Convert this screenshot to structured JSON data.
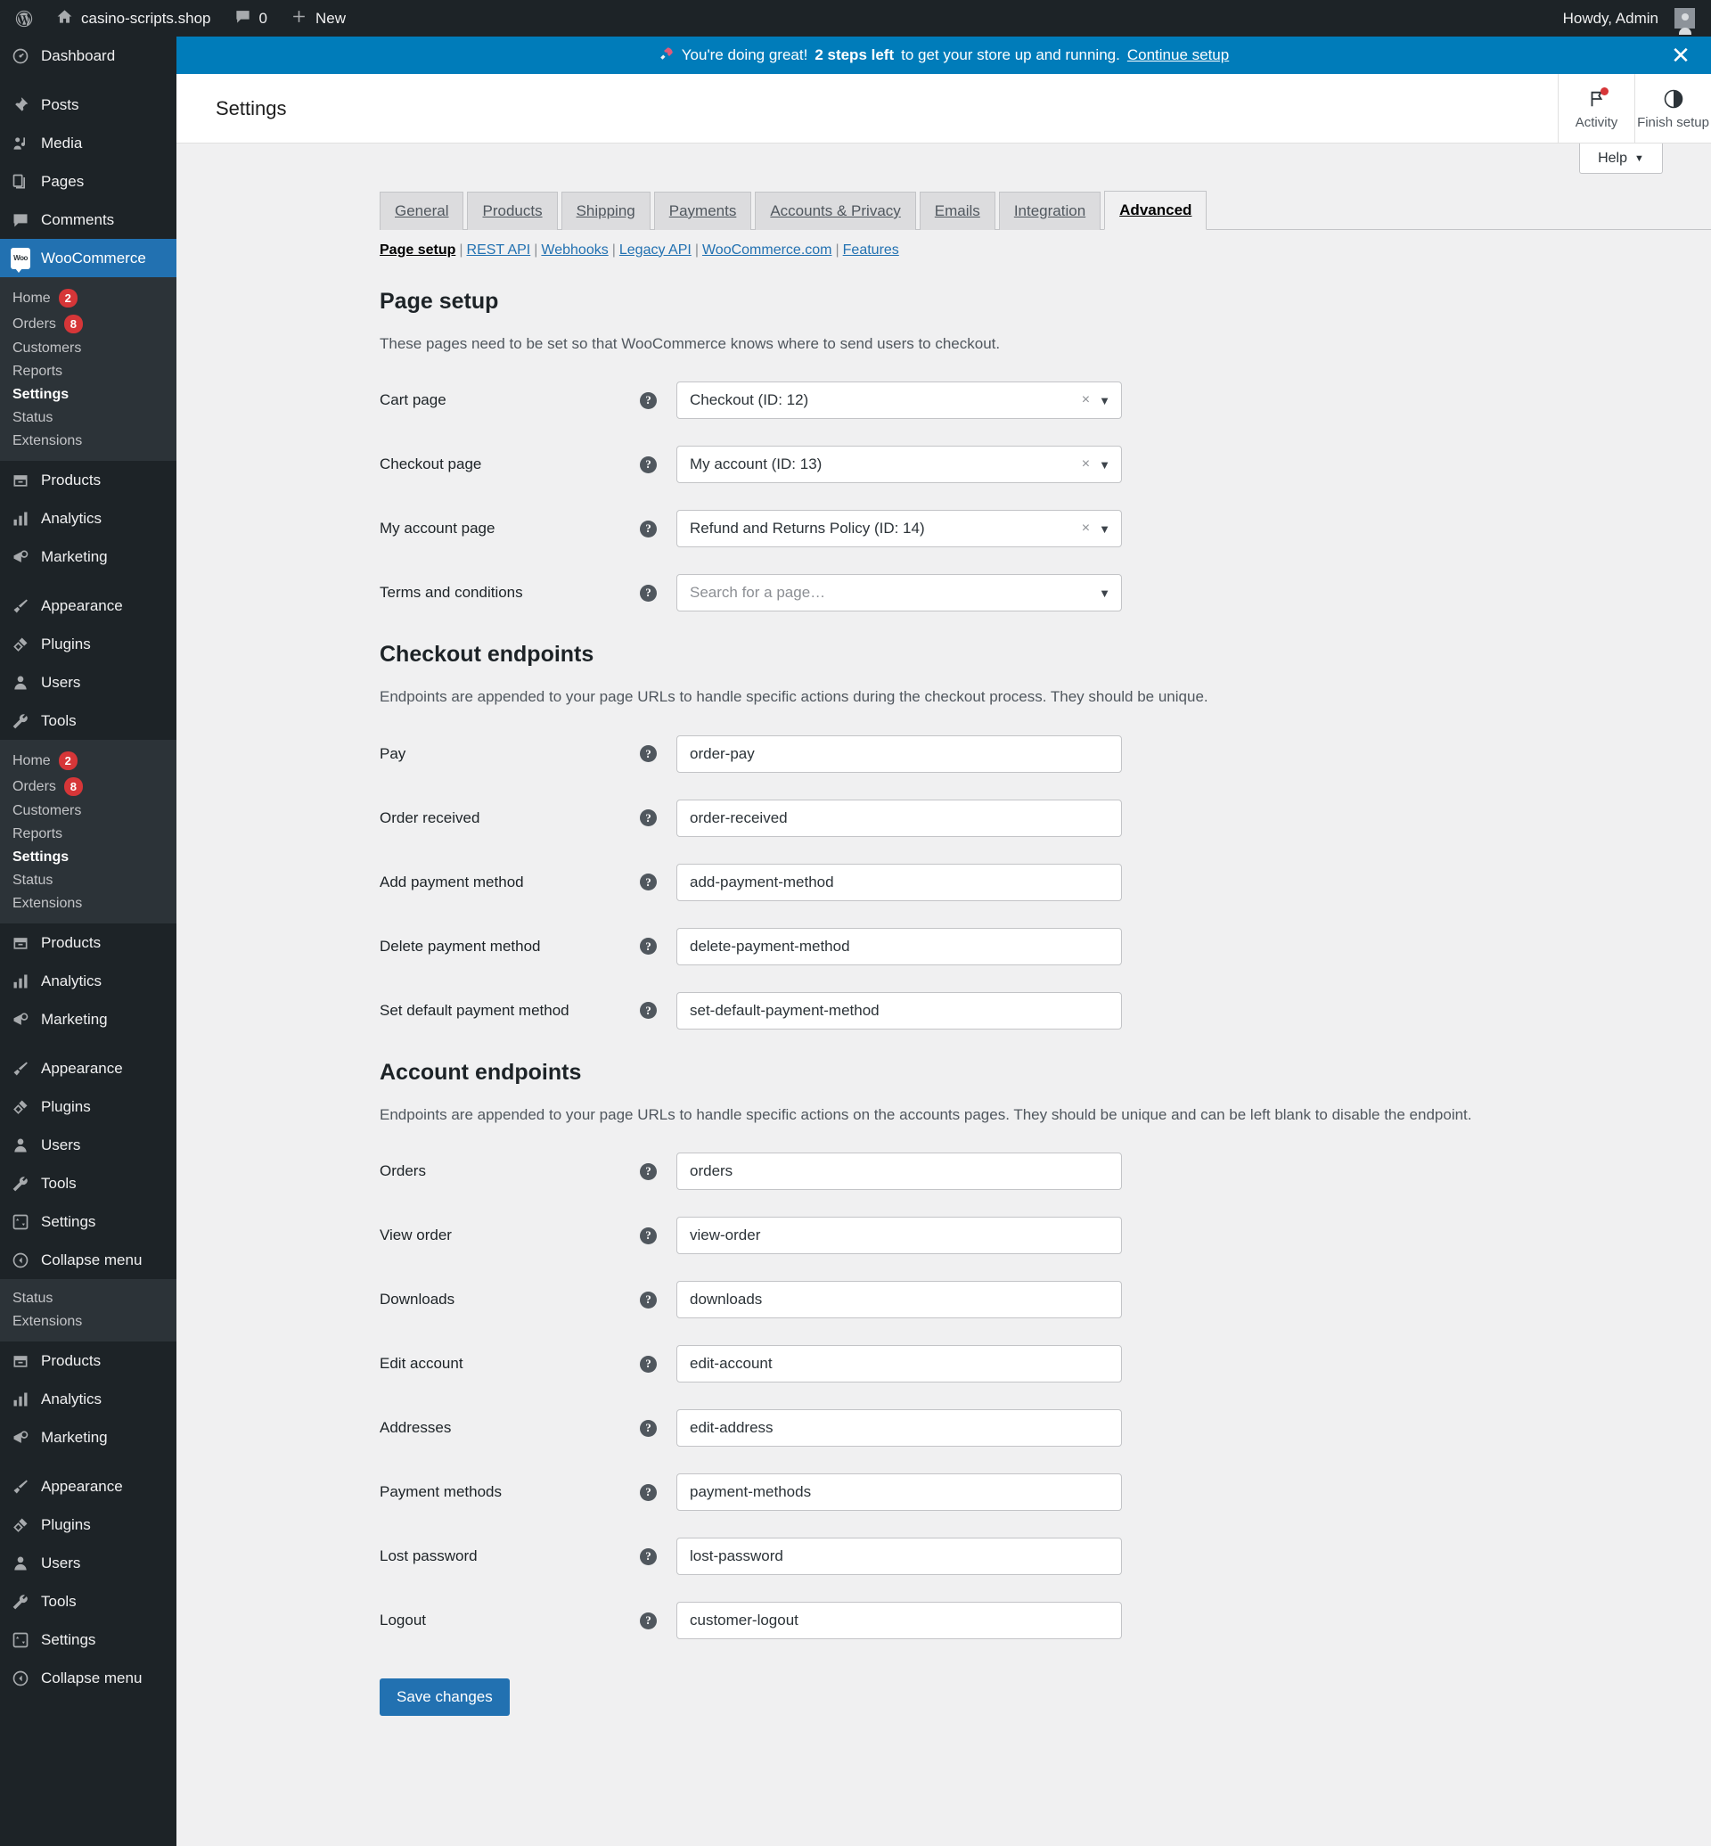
{
  "adminbar": {
    "site_name": "casino-scripts.shop",
    "comment_count": "0",
    "new_label": "New",
    "howdy": "Howdy, Admin",
    "wp_logo_icon": "wordpress-logo-icon",
    "home_icon": "home-icon",
    "comment_icon": "comment-bubble-icon",
    "plus_icon": "plus-icon",
    "avatar_icon": "user-avatar-icon"
  },
  "sidebar": {
    "top_items": [
      {
        "label": "Dashboard",
        "icon": "dashboard-gauge-icon",
        "sep": false,
        "current": false
      },
      {
        "label": "Posts",
        "icon": "pin-icon",
        "sep": true,
        "current": false
      },
      {
        "label": "Media",
        "icon": "media-icon",
        "sep": false,
        "current": false
      },
      {
        "label": "Pages",
        "icon": "pages-icon",
        "sep": false,
        "current": false
      },
      {
        "label": "Comments",
        "icon": "comment-bubble-icon",
        "sep": false,
        "current": false
      }
    ],
    "woocommerce": {
      "label": "WooCommerce",
      "icon": "woo-logo-icon"
    },
    "woo_submenu": [
      {
        "label": "Home",
        "badge": "2",
        "current": false
      },
      {
        "label": "Orders",
        "badge": "8",
        "current": false
      },
      {
        "label": "Customers",
        "badge": "",
        "current": false
      },
      {
        "label": "Reports",
        "badge": "",
        "current": false
      },
      {
        "label": "Settings",
        "badge": "",
        "current": true
      },
      {
        "label": "Status",
        "badge": "",
        "current": false
      },
      {
        "label": "Extensions",
        "badge": "",
        "current": false
      }
    ],
    "group_a": [
      {
        "label": "Products",
        "icon": "products-box-icon",
        "sep": false
      },
      {
        "label": "Analytics",
        "icon": "analytics-bars-icon",
        "sep": false
      },
      {
        "label": "Marketing",
        "icon": "megaphone-icon",
        "sep": false
      },
      {
        "label": "Appearance",
        "icon": "paintbrush-icon",
        "sep": true
      },
      {
        "label": "Plugins",
        "icon": "plug-icon",
        "sep": false
      },
      {
        "label": "Users",
        "icon": "user-icon",
        "sep": false
      },
      {
        "label": "Tools",
        "icon": "wrench-icon",
        "sep": false
      }
    ],
    "group_b": [
      {
        "label": "Products",
        "icon": "products-box-icon",
        "sep": false
      },
      {
        "label": "Analytics",
        "icon": "analytics-bars-icon",
        "sep": false
      },
      {
        "label": "Marketing",
        "icon": "megaphone-icon",
        "sep": false
      },
      {
        "label": "Appearance",
        "icon": "paintbrush-icon",
        "sep": true
      },
      {
        "label": "Plugins",
        "icon": "plug-icon",
        "sep": false
      },
      {
        "label": "Users",
        "icon": "user-icon",
        "sep": false
      },
      {
        "label": "Tools",
        "icon": "wrench-icon",
        "sep": false
      },
      {
        "label": "Settings",
        "icon": "settings-sliders-icon",
        "sep": false
      },
      {
        "label": "Collapse menu",
        "icon": "collapse-arrow-icon",
        "sep": false
      }
    ],
    "partial_submenu": [
      {
        "label": "Status"
      },
      {
        "label": "Extensions"
      }
    ],
    "group_c": [
      {
        "label": "Products",
        "icon": "products-box-icon",
        "sep": false
      },
      {
        "label": "Analytics",
        "icon": "analytics-bars-icon",
        "sep": false
      },
      {
        "label": "Marketing",
        "icon": "megaphone-icon",
        "sep": false
      },
      {
        "label": "Appearance",
        "icon": "paintbrush-icon",
        "sep": true
      },
      {
        "label": "Plugins",
        "icon": "plug-icon",
        "sep": false
      },
      {
        "label": "Users",
        "icon": "user-icon",
        "sep": false
      },
      {
        "label": "Tools",
        "icon": "wrench-icon",
        "sep": false
      },
      {
        "label": "Settings",
        "icon": "settings-sliders-icon",
        "sep": false
      },
      {
        "label": "Collapse menu",
        "icon": "collapse-arrow-icon",
        "sep": false
      }
    ]
  },
  "notice": {
    "rocket_icon": "rocket-icon",
    "prefix": "You're doing great!",
    "bold": "2 steps left",
    "suffix": "to get your store up and running.",
    "link": "Continue setup",
    "close_icon": "close-icon",
    "bg": "#007cba"
  },
  "header": {
    "title": "Settings",
    "activity": {
      "label": "Activity",
      "icon": "flag-icon",
      "has_dot": true
    },
    "finish_setup": {
      "label": "Finish setup",
      "icon": "progress-circle-icon"
    },
    "help": {
      "label": "Help",
      "icon": "chevron-down-icon"
    }
  },
  "tabs": [
    {
      "label": "General",
      "active": false
    },
    {
      "label": "Products",
      "active": false
    },
    {
      "label": "Shipping",
      "active": false
    },
    {
      "label": "Payments",
      "active": false
    },
    {
      "label": "Accounts & Privacy",
      "active": false
    },
    {
      "label": "Emails",
      "active": false
    },
    {
      "label": "Integration",
      "active": false
    },
    {
      "label": "Advanced",
      "active": true
    }
  ],
  "subnav": [
    {
      "label": "Page setup",
      "current": true
    },
    {
      "label": "REST API",
      "current": false
    },
    {
      "label": "Webhooks",
      "current": false
    },
    {
      "label": "Legacy API",
      "current": false
    },
    {
      "label": "WooCommerce.com",
      "current": false
    },
    {
      "label": "Features",
      "current": false
    }
  ],
  "page_setup": {
    "title": "Page setup",
    "description": "These pages need to be set so that WooCommerce knows where to send users to checkout.",
    "fields": [
      {
        "label": "Cart page",
        "value": "Checkout (ID: 12)",
        "placeholder": "",
        "clearable": true
      },
      {
        "label": "Checkout page",
        "value": "My account (ID: 13)",
        "placeholder": "",
        "clearable": true
      },
      {
        "label": "My account page",
        "value": "Refund and Returns Policy (ID: 14)",
        "placeholder": "",
        "clearable": true
      },
      {
        "label": "Terms and conditions",
        "value": "",
        "placeholder": "Search for a page…",
        "clearable": false
      }
    ]
  },
  "checkout_endpoints": {
    "title": "Checkout endpoints",
    "description": "Endpoints are appended to your page URLs to handle specific actions during the checkout process. They should be unique.",
    "fields": [
      {
        "label": "Pay",
        "value": "order-pay"
      },
      {
        "label": "Order received",
        "value": "order-received"
      },
      {
        "label": "Add payment method",
        "value": "add-payment-method"
      },
      {
        "label": "Delete payment method",
        "value": "delete-payment-method"
      },
      {
        "label": "Set default payment method",
        "value": "set-default-payment-method"
      }
    ]
  },
  "account_endpoints": {
    "title": "Account endpoints",
    "description": "Endpoints are appended to your page URLs to handle specific actions on the accounts pages. They should be unique and can be left blank to disable the endpoint.",
    "fields": [
      {
        "label": "Orders",
        "value": "orders"
      },
      {
        "label": "View order",
        "value": "view-order"
      },
      {
        "label": "Downloads",
        "value": "downloads"
      },
      {
        "label": "Edit account",
        "value": "edit-account"
      },
      {
        "label": "Addresses",
        "value": "edit-address"
      },
      {
        "label": "Payment methods",
        "value": "payment-methods"
      },
      {
        "label": "Lost password",
        "value": "lost-password"
      },
      {
        "label": "Logout",
        "value": "customer-logout"
      }
    ]
  },
  "save_button": {
    "label": "Save changes",
    "color": "#2271b1"
  }
}
